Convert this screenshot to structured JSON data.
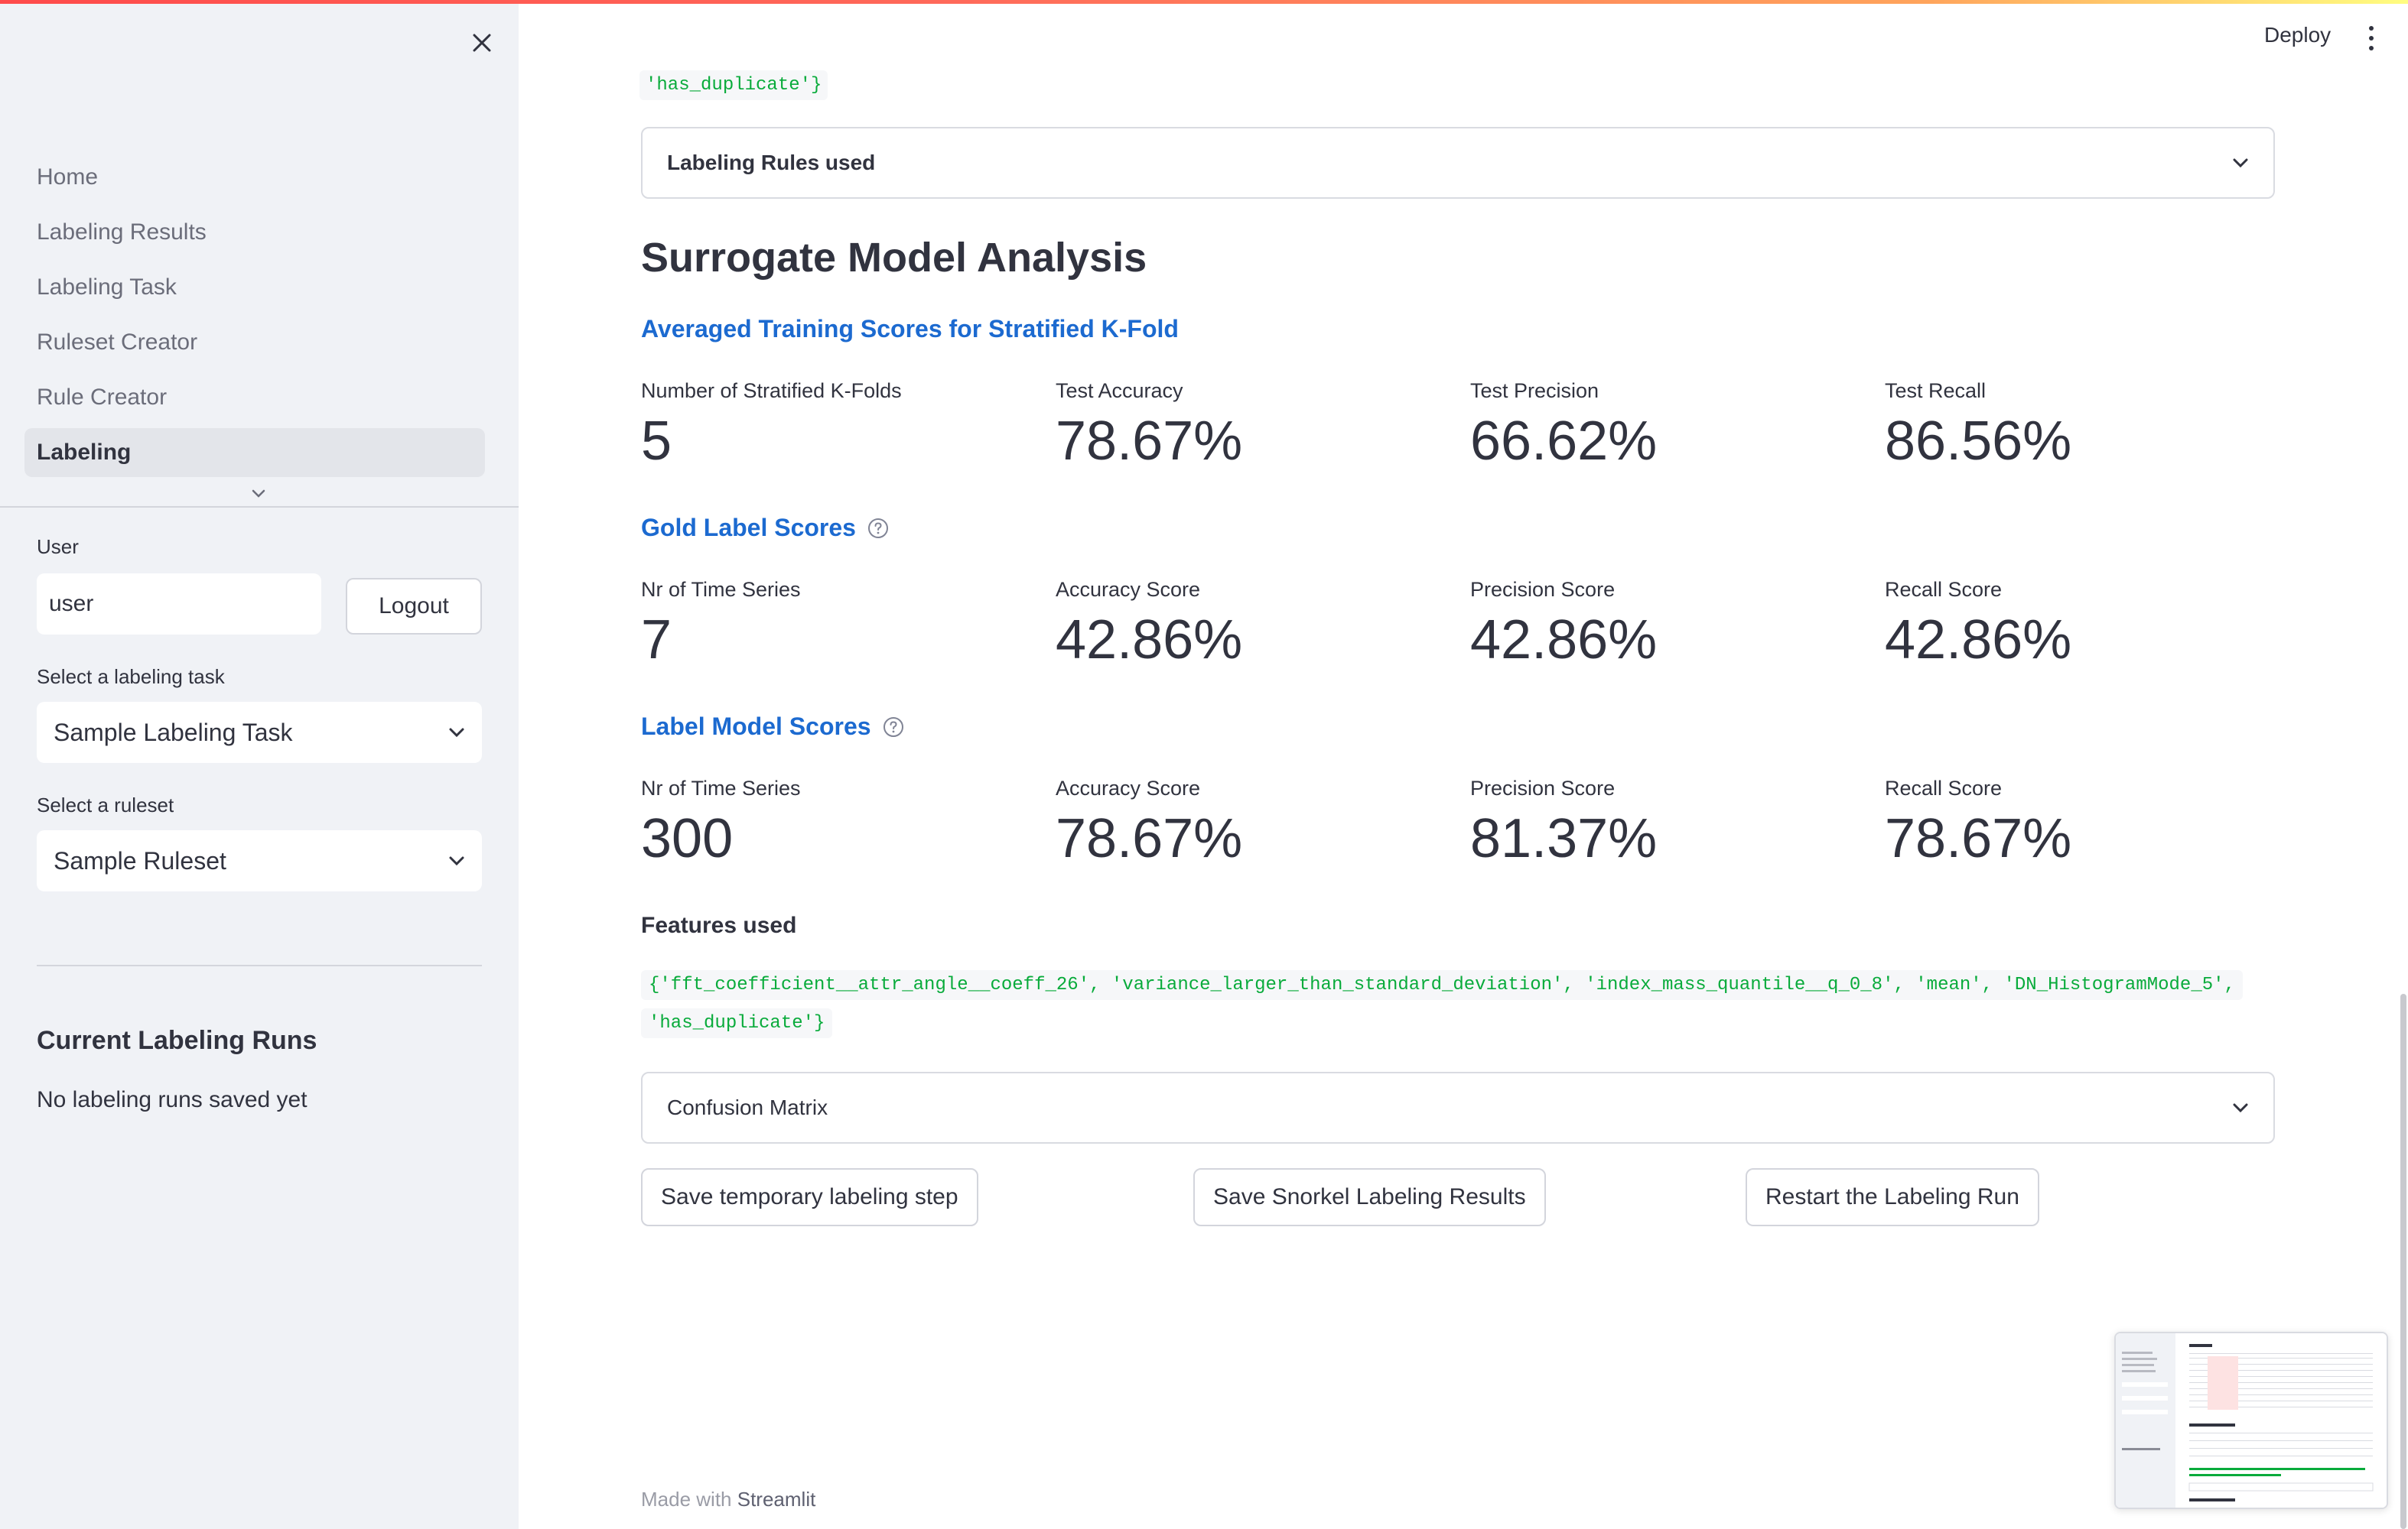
{
  "sidebar": {
    "nav_items": [
      {
        "label": "Home"
      },
      {
        "label": "Labeling Results"
      },
      {
        "label": "Labeling Task"
      },
      {
        "label": "Ruleset Creator"
      },
      {
        "label": "Rule Creator"
      },
      {
        "label": "Labeling",
        "active": true
      }
    ],
    "user_label": "User",
    "user_value": "user",
    "logout_label": "Logout",
    "task_select_label": "Select a labeling task",
    "task_select_value": "Sample Labeling Task",
    "ruleset_select_label": "Select a ruleset",
    "ruleset_select_value": "Sample Ruleset",
    "runs_heading": "Current Labeling Runs",
    "runs_text": "No labeling runs saved yet"
  },
  "header": {
    "deploy_label": "Deploy"
  },
  "main": {
    "top_code": "'has_duplicate'}",
    "labeling_rules_expander": "Labeling Rules used",
    "section_title": "Surrogate Model Analysis",
    "training_scores": {
      "title": "Averaged Training Scores for Stratified K-Fold",
      "metrics": [
        {
          "label": "Number of Stratified K-Folds",
          "value": "5"
        },
        {
          "label": "Test Accuracy",
          "value": "78.67%"
        },
        {
          "label": "Test Precision",
          "value": "66.62%"
        },
        {
          "label": "Test Recall",
          "value": "86.56%"
        }
      ]
    },
    "gold_label_scores": {
      "title": "Gold Label Scores",
      "metrics": [
        {
          "label": "Nr of Time Series",
          "value": "7"
        },
        {
          "label": "Accuracy Score",
          "value": "42.86%"
        },
        {
          "label": "Precision Score",
          "value": "42.86%"
        },
        {
          "label": "Recall Score",
          "value": "42.86%"
        }
      ]
    },
    "label_model_scores": {
      "title": "Label Model Scores",
      "metrics": [
        {
          "label": "Nr of Time Series",
          "value": "300"
        },
        {
          "label": "Accuracy Score",
          "value": "78.67%"
        },
        {
          "label": "Precision Score",
          "value": "81.37%"
        },
        {
          "label": "Recall Score",
          "value": "78.67%"
        }
      ]
    },
    "features_label": "Features used",
    "features_line1": "{'fft_coefficient__attr_angle__coeff_26', 'variance_larger_than_standard_deviation', 'index_mass_quantile__q_0_8', 'mean', 'DN_HistogramMode_5',",
    "features_line2": "'has_duplicate'}",
    "confusion_matrix_expander": "Confusion Matrix",
    "buttons": {
      "save_temp": "Save temporary labeling step",
      "save_snorkel": "Save Snorkel Labeling Results",
      "restart": "Restart the Labeling Run"
    },
    "footer_prefix": "Made with",
    "footer_brand": "Streamlit"
  }
}
